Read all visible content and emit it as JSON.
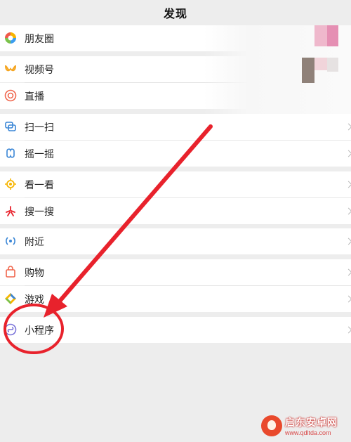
{
  "header": {
    "title": "发现"
  },
  "menu": [
    {
      "label": "朋友圈",
      "icon": "moments-icon"
    },
    {
      "label": "视频号",
      "icon": "channels-icon"
    },
    {
      "label": "直播",
      "icon": "live-icon"
    },
    {
      "label": "扫一扫",
      "icon": "scan-icon"
    },
    {
      "label": "摇一摇",
      "icon": "shake-icon"
    },
    {
      "label": "看一看",
      "icon": "top-stories-icon"
    },
    {
      "label": "搜一搜",
      "icon": "search-icon"
    },
    {
      "label": "附近",
      "icon": "nearby-icon"
    },
    {
      "label": "购物",
      "icon": "shopping-icon"
    },
    {
      "label": "游戏",
      "icon": "games-icon"
    },
    {
      "label": "小程序",
      "icon": "mini-programs-icon"
    }
  ],
  "watermark": {
    "name": "启东安卓网",
    "url": "www.qdltda.com"
  },
  "colors": {
    "background": "#ededed",
    "annotation": "#e8222c"
  }
}
